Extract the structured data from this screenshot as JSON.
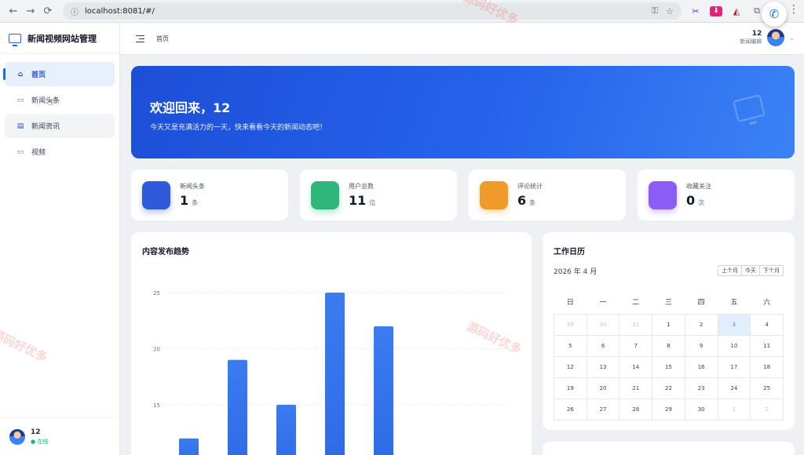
{
  "browser": {
    "url": "localhost:8081/#/"
  },
  "sidebar": {
    "app_title": "新闻视频网站管理",
    "items": [
      {
        "label": "首页"
      },
      {
        "label": "新闻头条"
      },
      {
        "label": "新闻资讯"
      },
      {
        "label": "视频"
      }
    ],
    "user_name": "12",
    "user_status": "● 在线"
  },
  "header": {
    "breadcrumb": "首页",
    "user_name": "12",
    "user_role": "新闻编辑"
  },
  "banner": {
    "title": "欢迎回来，12",
    "subtitle": "今天又是充满活力的一天，快来看看今天的新闻动态吧！"
  },
  "stats": [
    {
      "label": "新闻头条",
      "value": "1",
      "unit": "条",
      "color": "#2f5bdb"
    },
    {
      "label": "用户总数",
      "value": "11",
      "unit": "位",
      "color": "#2fb67a"
    },
    {
      "label": "评论统计",
      "value": "6",
      "unit": "条",
      "color": "#f09a2a"
    },
    {
      "label": "收藏关注",
      "value": "0",
      "unit": "次",
      "color": "#8b5cf6"
    }
  ],
  "chart": {
    "title": "内容发布趋势"
  },
  "chart_data": {
    "type": "bar",
    "title": "内容发布趋势",
    "categories": [
      "",
      "",
      "",
      "",
      ""
    ],
    "values": [
      12,
      19,
      15,
      25,
      22
    ],
    "y_ticks": [
      15,
      20,
      25
    ],
    "ylim": [
      12,
      27
    ],
    "grid": true,
    "color": "#2d6be6"
  },
  "calendar": {
    "title": "工作日历",
    "month": "2026 年 4 月",
    "buttons": [
      "上个月",
      "今天",
      "下个月"
    ],
    "weekdays": [
      "日",
      "一",
      "二",
      "三",
      "四",
      "五",
      "六"
    ],
    "weeks": [
      [
        "29",
        "30",
        "31",
        "1",
        "2",
        "3",
        "4"
      ],
      [
        "5",
        "6",
        "7",
        "8",
        "9",
        "10",
        "11"
      ],
      [
        "12",
        "13",
        "14",
        "15",
        "16",
        "17",
        "18"
      ],
      [
        "19",
        "20",
        "21",
        "22",
        "23",
        "24",
        "25"
      ],
      [
        "26",
        "27",
        "28",
        "29",
        "30",
        "1",
        "2"
      ]
    ],
    "today": "3"
  },
  "watermark": "源码好优多"
}
